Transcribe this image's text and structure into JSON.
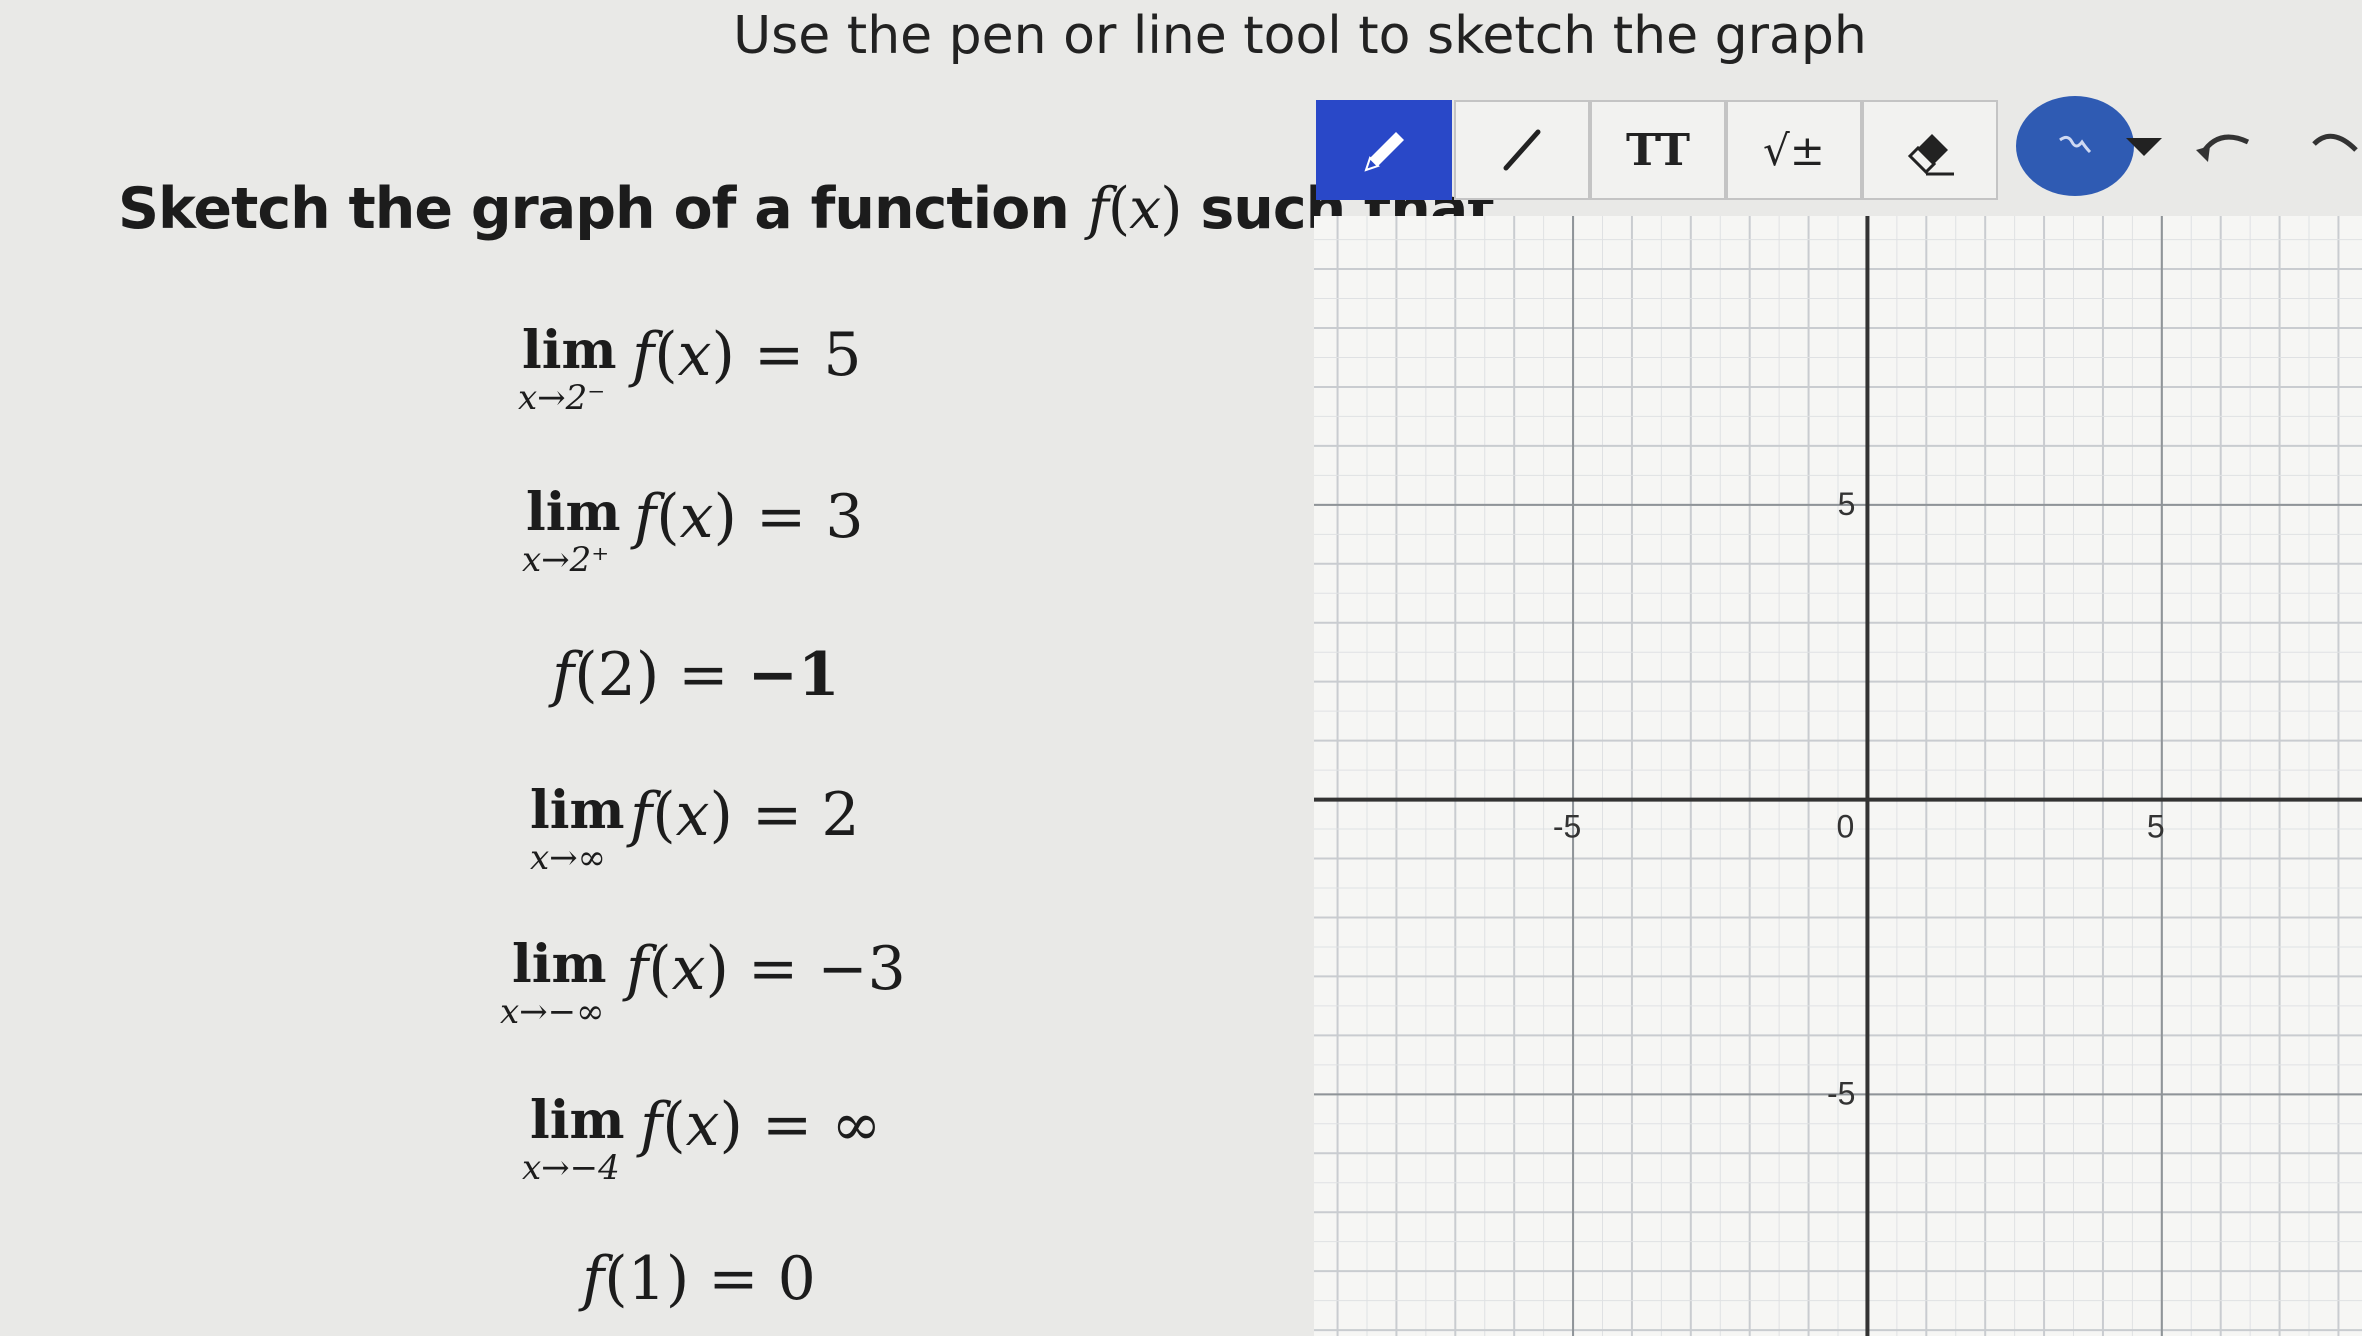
{
  "instruction": "Use the pen or line tool to sketch the graph",
  "heading": {
    "lead": "Sketch the graph of a function ",
    "f": "f",
    "x": "x",
    "tail": " such that..."
  },
  "conditions": [
    {
      "lim": "lim",
      "sub": "x→2⁻",
      "f": "f",
      "x": "x",
      "value": "5"
    },
    {
      "lim": "lim",
      "sub": "x→2⁺",
      "f": "f",
      "x": "x",
      "value": "3"
    },
    {
      "f": "f",
      "arg": "2",
      "value": "−1"
    },
    {
      "lim": "lim",
      "sub": "x→∞",
      "f": "f",
      "x": "x",
      "value": "2"
    },
    {
      "lim": "lim",
      "sub": "x→−∞",
      "f": "f",
      "x": "x",
      "value": "−3"
    },
    {
      "lim": "lim",
      "sub": "x→−4",
      "f": "f",
      "x": "x",
      "value": "∞"
    },
    {
      "f": "f",
      "arg": "1",
      "value": "0"
    }
  ],
  "toolbar": {
    "text_tool": "TT",
    "math_tool": "√±",
    "active_tool": "pen",
    "colors": {
      "active": "#2948c8",
      "picker": "#2f5bb3"
    },
    "icons": [
      "pen-icon",
      "line-icon",
      "text-icon",
      "math-icon",
      "eraser-icon",
      "color-picker-icon",
      "dropdown-icon",
      "undo-icon",
      "redo-icon"
    ]
  },
  "graph": {
    "x_labels": [
      "-5",
      "0",
      "5"
    ],
    "y_labels": [
      "5",
      "-5"
    ],
    "x_range": [
      -9.4,
      8.4
    ],
    "y_range": [
      -9.1,
      9.9
    ],
    "grid_step": 1
  }
}
